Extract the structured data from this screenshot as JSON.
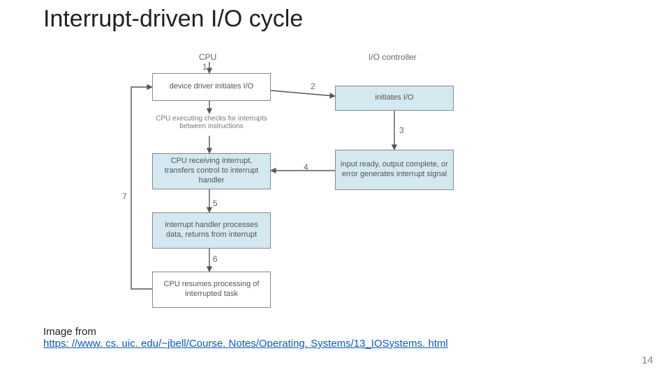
{
  "title": "Interrupt-driven I/O cycle",
  "columns": {
    "cpu": "CPU",
    "io": "I/O controller"
  },
  "boxes": {
    "b1": "device driver initiates I/O",
    "b2": "initiates I/O",
    "b3": "input ready, output complete, or error generates interrupt signal",
    "b4": "CPU receiving interrupt, transfers control to interrupt handler",
    "b5": "interrupt handler processes data, returns from interrupt",
    "b6": "CPU resumes processing of interrupted task"
  },
  "inter_caption": "CPU executing checks for interrupts between instructions",
  "edge_labels": {
    "e1": "1",
    "e2": "2",
    "e3": "3",
    "e4": "4",
    "e5": "5",
    "e6": "6",
    "e7": "7"
  },
  "credit_prefix": "Image from",
  "credit_link": "https: //www. cs. uic. edu/~jbell/Course. Notes/Operating. Systems/13_IOSystems. html",
  "page_number": "14",
  "chart_data": {
    "type": "flow-diagram",
    "columns": [
      "CPU",
      "I/O controller"
    ],
    "nodes": [
      {
        "id": "b1",
        "column": "CPU",
        "label": "device driver initiates I/O"
      },
      {
        "id": "b2",
        "column": "I/O controller",
        "label": "initiates I/O"
      },
      {
        "id": "b3",
        "column": "I/O controller",
        "label": "input ready, output complete, or error generates interrupt signal"
      },
      {
        "id": "b4",
        "column": "CPU",
        "label": "CPU receiving interrupt, transfers control to interrupt handler"
      },
      {
        "id": "b5",
        "column": "CPU",
        "label": "interrupt handler processes data, returns from interrupt"
      },
      {
        "id": "b6",
        "column": "CPU",
        "label": "CPU resumes processing of interrupted task"
      }
    ],
    "edges": [
      {
        "id": "e1",
        "from": "start",
        "to": "b1",
        "label": "1"
      },
      {
        "id": "e2",
        "from": "b1",
        "to": "b2",
        "label": "2"
      },
      {
        "id": "e3",
        "from": "b2",
        "to": "b3",
        "label": "3"
      },
      {
        "id": "e4",
        "from": "b3",
        "to": "b4",
        "label": "4"
      },
      {
        "id": "e5",
        "from": "b4",
        "to": "b5",
        "label": "5"
      },
      {
        "id": "e6",
        "from": "b5",
        "to": "b6",
        "label": "6"
      },
      {
        "id": "e7",
        "from": "b6",
        "to": "b1",
        "label": "7"
      }
    ],
    "caption_between_b1_b4": "CPU executing checks for interrupts between instructions"
  }
}
